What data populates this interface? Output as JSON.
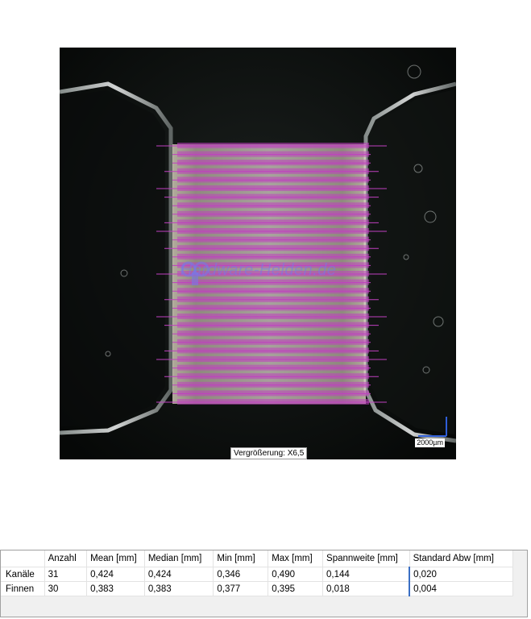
{
  "image": {
    "magnification_label": "Vergrößerung: X6,5",
    "scale_bar_label": "2000µm",
    "watermark_text": "Hardware-Helden.de",
    "overlay_color": "#c040c0",
    "measured_lines": 31
  },
  "table": {
    "headers": [
      "",
      "Anzahl",
      "Mean [mm]",
      "Median [mm]",
      "Min [mm]",
      "Max [mm]",
      "Spannweite [mm]",
      "Standard Abw [mm]"
    ],
    "rows": [
      [
        "Kanäle",
        "31",
        "0,424",
        "0,424",
        "0,346",
        "0,490",
        "0,144",
        "0,020"
      ],
      [
        "Finnen",
        "30",
        "0,383",
        "0,383",
        "0,377",
        "0,395",
        "0,018",
        "0,004"
      ]
    ]
  }
}
